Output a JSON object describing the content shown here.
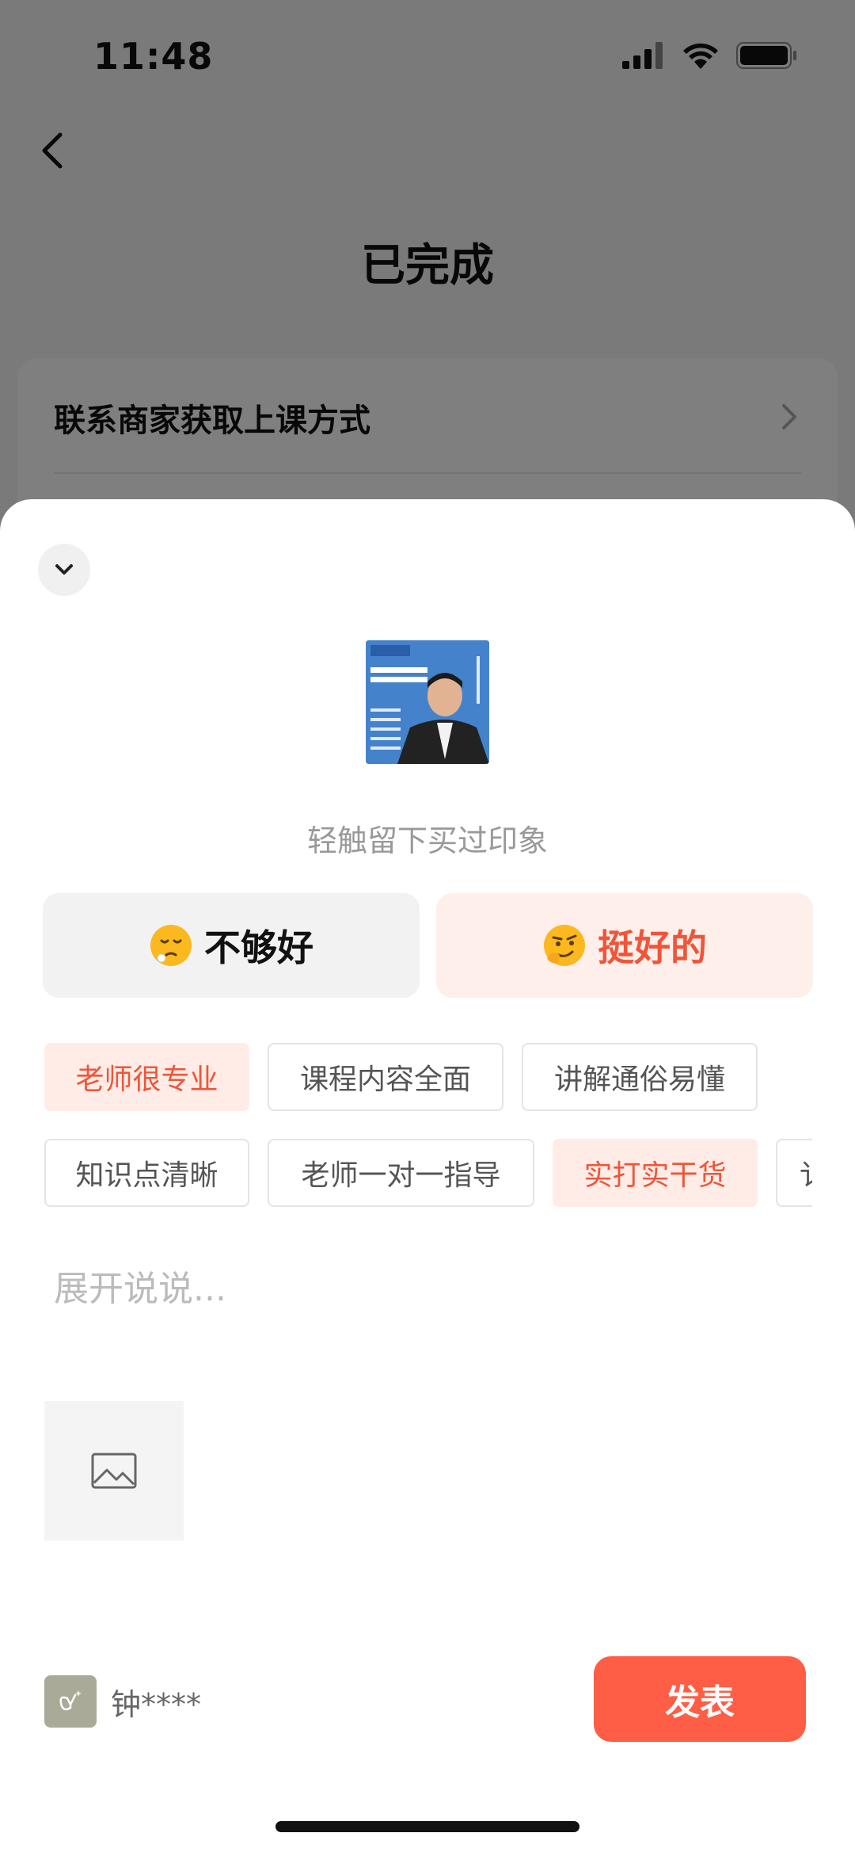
{
  "status_bar": {
    "time": "11:48"
  },
  "page": {
    "title": "已完成",
    "card_text": "联系商家获取上课方式"
  },
  "sheet": {
    "hint": "轻触留下买过印象",
    "rating": {
      "bad_label": "不够好",
      "good_label": "挺好的",
      "selected": "good"
    },
    "tags": [
      {
        "label": "老师很专业",
        "selected": true
      },
      {
        "label": "课程内容全面",
        "selected": false
      },
      {
        "label": "讲解通俗易懂",
        "selected": false
      },
      {
        "label": "知识点清晰",
        "selected": false
      },
      {
        "label": "老师一对一指导",
        "selected": false
      },
      {
        "label": "实打实干货",
        "selected": true
      },
      {
        "label": "讠",
        "selected": false
      }
    ],
    "input_placeholder": "展开说说..."
  },
  "footer": {
    "user_name": "钟****",
    "publish_label": "发表"
  },
  "colors": {
    "accent": "#fe5e45",
    "accent_text": "#f0553a",
    "accent_bg": "#ffece6"
  }
}
